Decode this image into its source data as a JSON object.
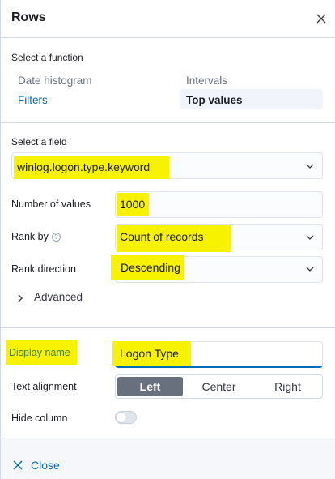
{
  "header": {
    "title": "Rows",
    "close_icon": "close-icon"
  },
  "function_section": {
    "label": "Select a function",
    "options": [
      {
        "label": "Date histogram",
        "state": "default"
      },
      {
        "label": "Intervals",
        "state": "default"
      },
      {
        "label": "Filters",
        "state": "link"
      },
      {
        "label": "Top values",
        "state": "selected"
      }
    ]
  },
  "field_section": {
    "label": "Select a field",
    "value": "winlog.logon.type.keyword"
  },
  "number_of_values": {
    "label": "Number of values",
    "value": "1000"
  },
  "rank_by": {
    "label": "Rank by",
    "help": "?",
    "value": "Count of records"
  },
  "rank_direction": {
    "label": "Rank direction",
    "value": "Descending"
  },
  "advanced": {
    "label": "Advanced"
  },
  "display_name": {
    "label": "Display name",
    "value": "Logon Type"
  },
  "text_alignment": {
    "label": "Text alignment",
    "options": [
      "Left",
      "Center",
      "Right"
    ],
    "selected": "Left"
  },
  "hide_column": {
    "label": "Hide column",
    "enabled": false
  },
  "footer": {
    "close_label": "Close"
  },
  "colors": {
    "highlight": "#f7f200",
    "link": "#006bb8",
    "selected_bg": "#69707d"
  }
}
